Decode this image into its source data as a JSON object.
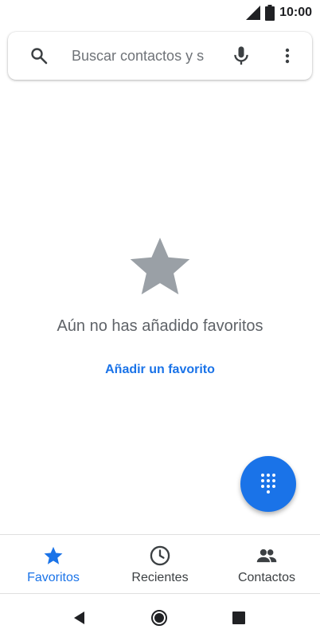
{
  "status_bar": {
    "time": "10:00"
  },
  "search": {
    "placeholder": "Buscar contactos y s"
  },
  "empty_state": {
    "message": "Aún no has añadido favoritos",
    "action_label": "Añadir un favorito"
  },
  "fab": {
    "icon": "dialpad-icon"
  },
  "bottom_nav": {
    "items": [
      {
        "label": "Favoritos",
        "icon": "star-icon",
        "active": true
      },
      {
        "label": "Recientes",
        "icon": "clock-icon",
        "active": false
      },
      {
        "label": "Contactos",
        "icon": "people-icon",
        "active": false
      }
    ]
  },
  "colors": {
    "accent": "#1a73e8",
    "muted": "#5f6368",
    "empty_star": "#9aa0a6"
  }
}
